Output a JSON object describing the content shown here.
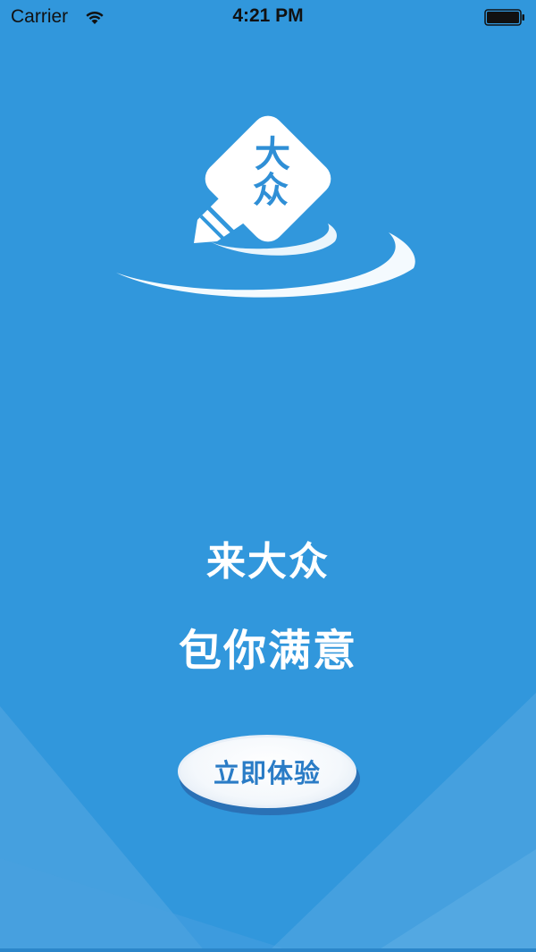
{
  "status_bar": {
    "carrier": "Carrier",
    "time": "4:21 PM",
    "wifi_icon": "wifi-icon",
    "battery_icon": "battery-full-icon"
  },
  "logo": {
    "line1": "大",
    "line2": "众",
    "icon": "pen-logo-icon"
  },
  "slogan": {
    "line1": "来大众",
    "line2": "包你满意"
  },
  "cta": {
    "label": "立即体验"
  },
  "colors": {
    "background": "#3197dc",
    "button_text": "#2a7cc6",
    "text": "#ffffff"
  }
}
